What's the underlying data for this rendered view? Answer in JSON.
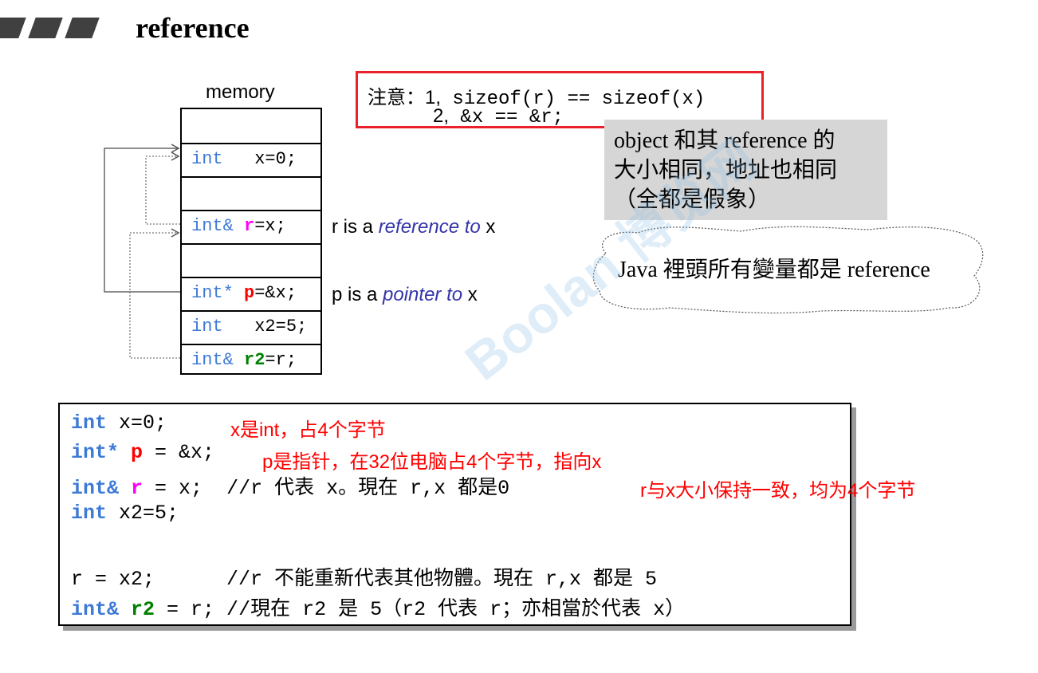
{
  "header": {
    "title": "reference"
  },
  "memory": {
    "label": "memory",
    "cells": [
      {
        "kw": "int  ",
        "name": "",
        "rest": " x=0;"
      },
      {
        "kw": "int& ",
        "name": "r",
        "rest": "=x;"
      },
      {
        "kw": "int* ",
        "name": "p",
        "rest": "=&x;"
      },
      {
        "kw": "int  ",
        "name": "",
        "rest": " x2=5;"
      },
      {
        "kw": "int& ",
        "name": "r2",
        "rest": "=r;"
      }
    ],
    "ref_label": {
      "pre": "r is a ",
      "italic": "reference to",
      "post": " x"
    },
    "ptr_label": {
      "pre": "p is a ",
      "italic": "pointer to",
      "post": " x"
    }
  },
  "note": {
    "prefix": "注意：",
    "item1_num": "1,",
    "item1_code": " sizeof(r) == sizeof(x)",
    "item2_num": "2,",
    "item2_code": " &x == &r;"
  },
  "gray_box": {
    "line1": "object 和其 reference 的",
    "line2": "大小相同，地址也相同",
    "line3": "（全都是假象）"
  },
  "cloud": {
    "text": "Java 裡頭所有變量都是 reference"
  },
  "code": {
    "line1": {
      "kw": "int",
      "rest": " x=0;"
    },
    "line2": {
      "kw": "int*",
      "var": "p",
      "rest": " = &x;"
    },
    "line3": {
      "kw": "int&",
      "var": "r",
      "rest": " = x;  //r 代表 x。現在 r,x 都是0"
    },
    "line4": {
      "kw": "int",
      "rest": " x2=5;"
    },
    "line5": {
      "text": "r = x2;      //r 不能重新代表其他物體。現在 r,x 都是 5"
    },
    "line6": {
      "kw": "int&",
      "var": "r2",
      "rest": " = r; //現在 r2 是 5（r2 代表 r；亦相當於代表 x）"
    },
    "note1": "x是int，占4个字节",
    "note2": "p是指针，在32位电脑占4个字节，指向x",
    "note3": "r与x大小保持一致，均为4个字节"
  },
  "colors": {
    "keyword": "#3d7ad6",
    "reference_var": "#ff00ff",
    "pointer_var": "#ff0000",
    "r2_var": "#008000",
    "note_border": "#e8212a",
    "gray_box": "#d6d6d6"
  },
  "watermark": "Boolan 博览网"
}
